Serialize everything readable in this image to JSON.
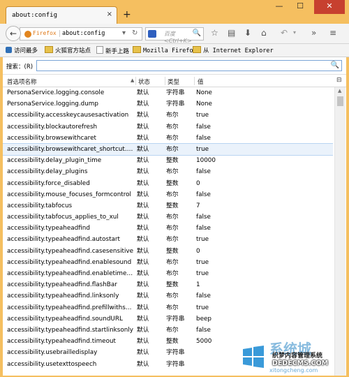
{
  "tab": {
    "title": "about:config",
    "close": "×",
    "new_tab": "+"
  },
  "window": {
    "minimize": "—",
    "maximize": "☐",
    "close": "✕"
  },
  "nav": {
    "back": "←",
    "brand": "Firefox",
    "url": "about:config",
    "dropdown": "▾",
    "reload": "↻",
    "search_placeholder": "百度 <Ctrl+K>",
    "search_go": "🔍",
    "bookmark_star": "☆",
    "library": "▤",
    "download": "⬇",
    "home": "⌂",
    "undo": "↶",
    "undo_menu": "▾",
    "overflow": "»",
    "menu": "≡"
  },
  "bookmarks": [
    {
      "label": "访问最多"
    },
    {
      "label": "火狐官方站点"
    },
    {
      "label": "新手上路"
    },
    {
      "label": "Mozilla Firefox"
    },
    {
      "label": "从 Internet Explorer"
    }
  ],
  "filter": {
    "label": "搜索：(R)",
    "value": "",
    "search_icon": "🔍"
  },
  "columns": {
    "name": "首选项名称",
    "status": "状态",
    "type": "类型",
    "value": "值",
    "sort_indicator": "▲",
    "picker": "⊟"
  },
  "scrollbar": {
    "up": "▲"
  },
  "rows": [
    {
      "name": "PersonaService.logging.console",
      "status": "默认",
      "type": "字符串",
      "value": "None"
    },
    {
      "name": "PersonaService.logging.dump",
      "status": "默认",
      "type": "字符串",
      "value": "None"
    },
    {
      "name": "accessibility.accesskeycausesactivation",
      "status": "默认",
      "type": "布尔",
      "value": "true"
    },
    {
      "name": "accessibility.blockautorefresh",
      "status": "默认",
      "type": "布尔",
      "value": "false"
    },
    {
      "name": "accessibility.browsewithcaret",
      "status": "默认",
      "type": "布尔",
      "value": "false"
    },
    {
      "name": "accessibility.browsewithcaret_shortcut.enabled",
      "status": "默认",
      "type": "布尔",
      "value": "true"
    },
    {
      "name": "accessibility.delay_plugin_time",
      "status": "默认",
      "type": "整数",
      "value": "10000"
    },
    {
      "name": "accessibility.delay_plugins",
      "status": "默认",
      "type": "布尔",
      "value": "false"
    },
    {
      "name": "accessibility.force_disabled",
      "status": "默认",
      "type": "整数",
      "value": "0"
    },
    {
      "name": "accessibility.mouse_focuses_formcontrol",
      "status": "默认",
      "type": "布尔",
      "value": "false"
    },
    {
      "name": "accessibility.tabfocus",
      "status": "默认",
      "type": "整数",
      "value": "7"
    },
    {
      "name": "accessibility.tabfocus_applies_to_xul",
      "status": "默认",
      "type": "布尔",
      "value": "false"
    },
    {
      "name": "accessibility.typeaheadfind",
      "status": "默认",
      "type": "布尔",
      "value": "false"
    },
    {
      "name": "accessibility.typeaheadfind.autostart",
      "status": "默认",
      "type": "布尔",
      "value": "true"
    },
    {
      "name": "accessibility.typeaheadfind.casesensitive",
      "status": "默认",
      "type": "整数",
      "value": "0"
    },
    {
      "name": "accessibility.typeaheadfind.enablesound",
      "status": "默认",
      "type": "布尔",
      "value": "true"
    },
    {
      "name": "accessibility.typeaheadfind.enabletimeout",
      "status": "默认",
      "type": "布尔",
      "value": "true"
    },
    {
      "name": "accessibility.typeaheadfind.flashBar",
      "status": "默认",
      "type": "整数",
      "value": "1"
    },
    {
      "name": "accessibility.typeaheadfind.linksonly",
      "status": "默认",
      "type": "布尔",
      "value": "false"
    },
    {
      "name": "accessibility.typeaheadfind.prefillwithselection",
      "status": "默认",
      "type": "布尔",
      "value": "true"
    },
    {
      "name": "accessibility.typeaheadfind.soundURL",
      "status": "默认",
      "type": "字符串",
      "value": "beep"
    },
    {
      "name": "accessibility.typeaheadfind.startlinksonly",
      "status": "默认",
      "type": "布尔",
      "value": "false"
    },
    {
      "name": "accessibility.typeaheadfind.timeout",
      "status": "默认",
      "type": "整数",
      "value": "5000"
    },
    {
      "name": "accessibility.usebrailledisplay",
      "status": "默认",
      "type": "字符串",
      "value": ""
    },
    {
      "name": "accessibility.usetexttospeech",
      "status": "默认",
      "type": "字符串",
      "value": ""
    }
  ],
  "selected_row": 5,
  "watermark": {
    "name": "系统城",
    "line1": "织梦内容管理系统",
    "line2": "DEDECMS.COM",
    "url": "xitongcheng.com"
  },
  "colors": {
    "frame": "#f5bf60",
    "selection": "#eaf2fb",
    "accent": "#2a86c6"
  }
}
